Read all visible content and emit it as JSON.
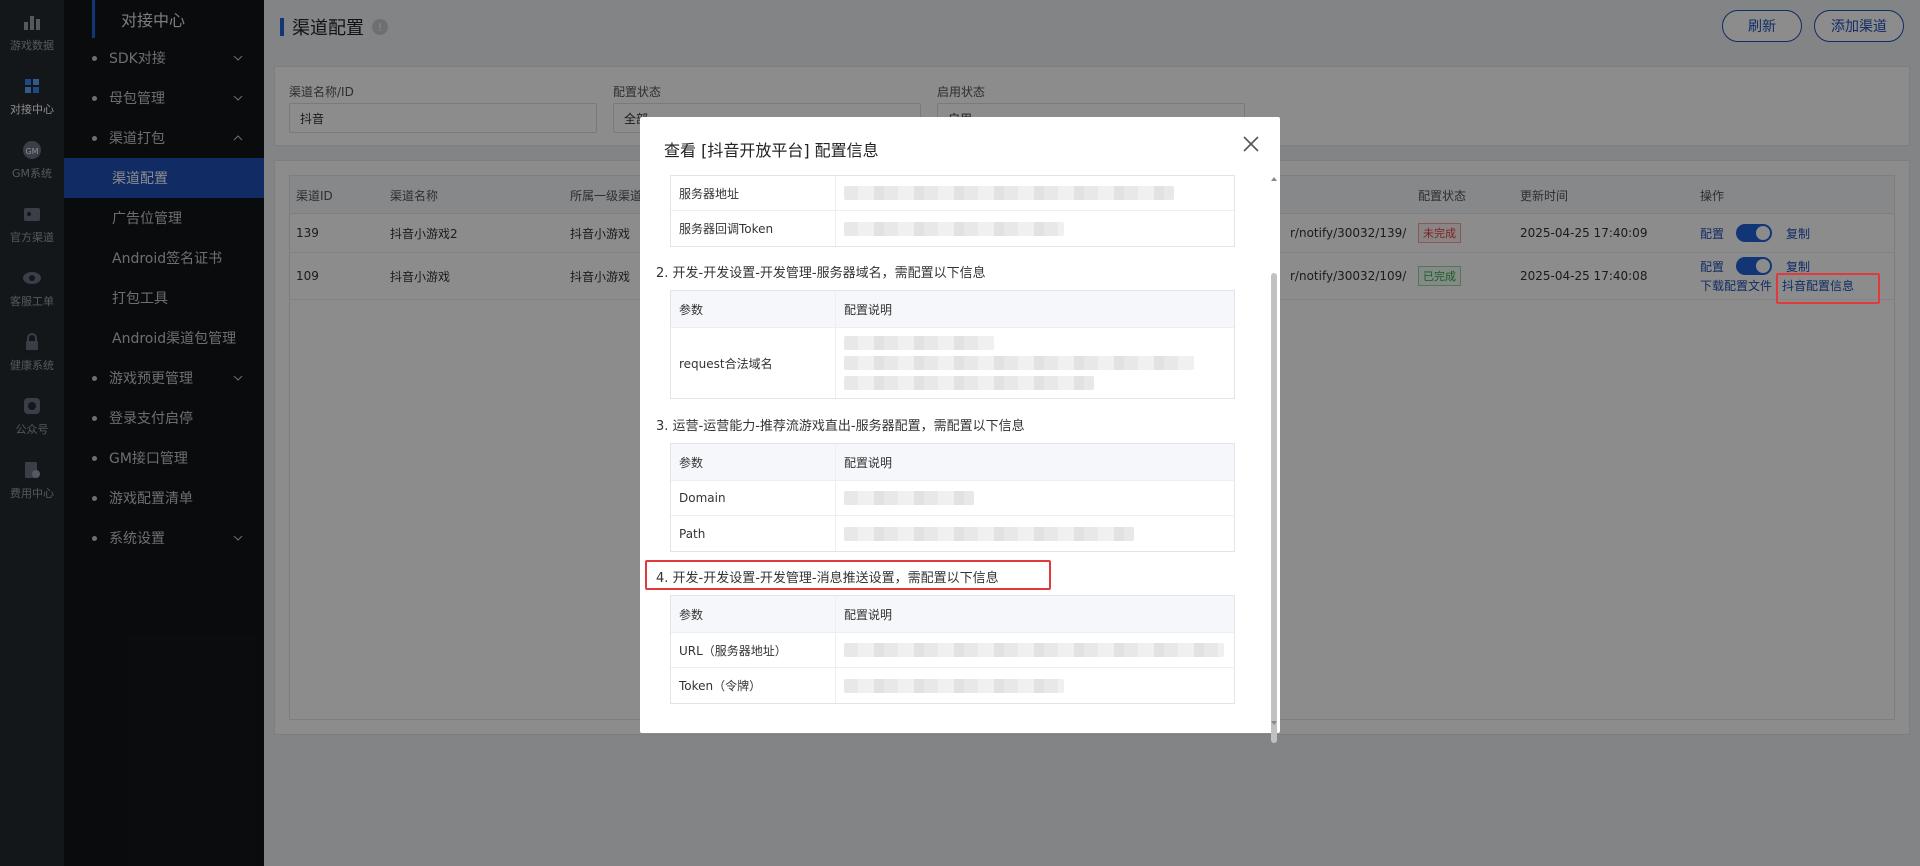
{
  "rail": [
    {
      "label": "游戏数据",
      "icon": "bar-chart-icon"
    },
    {
      "label": "对接中心",
      "icon": "puzzle-icon",
      "active": true
    },
    {
      "label": "GM系统",
      "icon": "gm-icon"
    },
    {
      "label": "官方渠道",
      "icon": "store-icon"
    },
    {
      "label": "客服工单",
      "icon": "headset-icon"
    },
    {
      "label": "健康系统",
      "icon": "lock-icon"
    },
    {
      "label": "公众号",
      "icon": "chat-icon"
    },
    {
      "label": "费用中心",
      "icon": "wallet-icon"
    }
  ],
  "sidebar": {
    "title": "对接中心",
    "menus": [
      {
        "label": "SDK对接",
        "expandable": true
      },
      {
        "label": "母包管理",
        "expandable": true
      },
      {
        "label": "渠道打包",
        "expandable": true,
        "open": true
      }
    ],
    "subs": [
      "渠道配置",
      "广告位管理",
      "Android签名证书",
      "打包工具",
      "Android渠道包管理"
    ],
    "menus2": [
      {
        "label": "游戏预更管理",
        "expandable": true
      },
      {
        "label": "登录支付启停"
      },
      {
        "label": "GM接口管理"
      },
      {
        "label": "游戏配置清单"
      },
      {
        "label": "系统设置",
        "expandable": true
      }
    ]
  },
  "header": {
    "title": "渠道配置",
    "refresh": "刷新",
    "add": "添加渠道"
  },
  "filters": {
    "name_label": "渠道名称/ID",
    "name_value": "抖音",
    "config_label": "配置状态",
    "config_value": "全部",
    "enable_label": "启用状态",
    "enable_value": "启用"
  },
  "table": {
    "headers": [
      "渠道ID",
      "渠道名称",
      "所属一级渠道",
      "配置状态",
      "更新时间",
      "操作"
    ],
    "rows": [
      {
        "id": "139",
        "name": "抖音小游戏2",
        "parent": "抖音小游戏",
        "url_tail": "r/notify/30032/139/",
        "status": "未完成",
        "time": "2025-04-25 17:40:09",
        "op_config": "配置",
        "op_copy": "复制"
      },
      {
        "id": "109",
        "name": "抖音小游戏",
        "parent": "抖音小游戏",
        "url_tail": "r/notify/30032/109/",
        "status": "已完成",
        "time": "2025-04-25 17:40:08",
        "op_config": "配置",
        "op_copy": "复制",
        "op_download": "下载配置文件",
        "op_douyin": "抖音配置信息"
      }
    ]
  },
  "modal": {
    "title": "查看 [抖音开放平台] 配置信息",
    "top_rows": [
      "服务器地址",
      "服务器回调Token"
    ],
    "sections": [
      {
        "title": "2. 开发-开发设置-开发管理-服务器域名，需配置以下信息",
        "h1": "参数",
        "h2": "配置说明",
        "rows": [
          "request合法域名"
        ]
      },
      {
        "title": "3. 运营-运营能力-推荐流游戏直出-服务器配置，需配置以下信息",
        "h1": "参数",
        "h2": "配置说明",
        "rows": [
          "Domain",
          "Path"
        ]
      },
      {
        "title": "4. 开发-开发设置-开发管理-消息推送设置，需配置以下信息",
        "h1": "参数",
        "h2": "配置说明",
        "rows": [
          "URL（服务器地址）",
          "Token（令牌）"
        ]
      }
    ]
  },
  "colors": {
    "accent": "#1f4fb8",
    "highlight": "#e23a3a",
    "sidebar": "#131519",
    "rail": "#262a31"
  }
}
